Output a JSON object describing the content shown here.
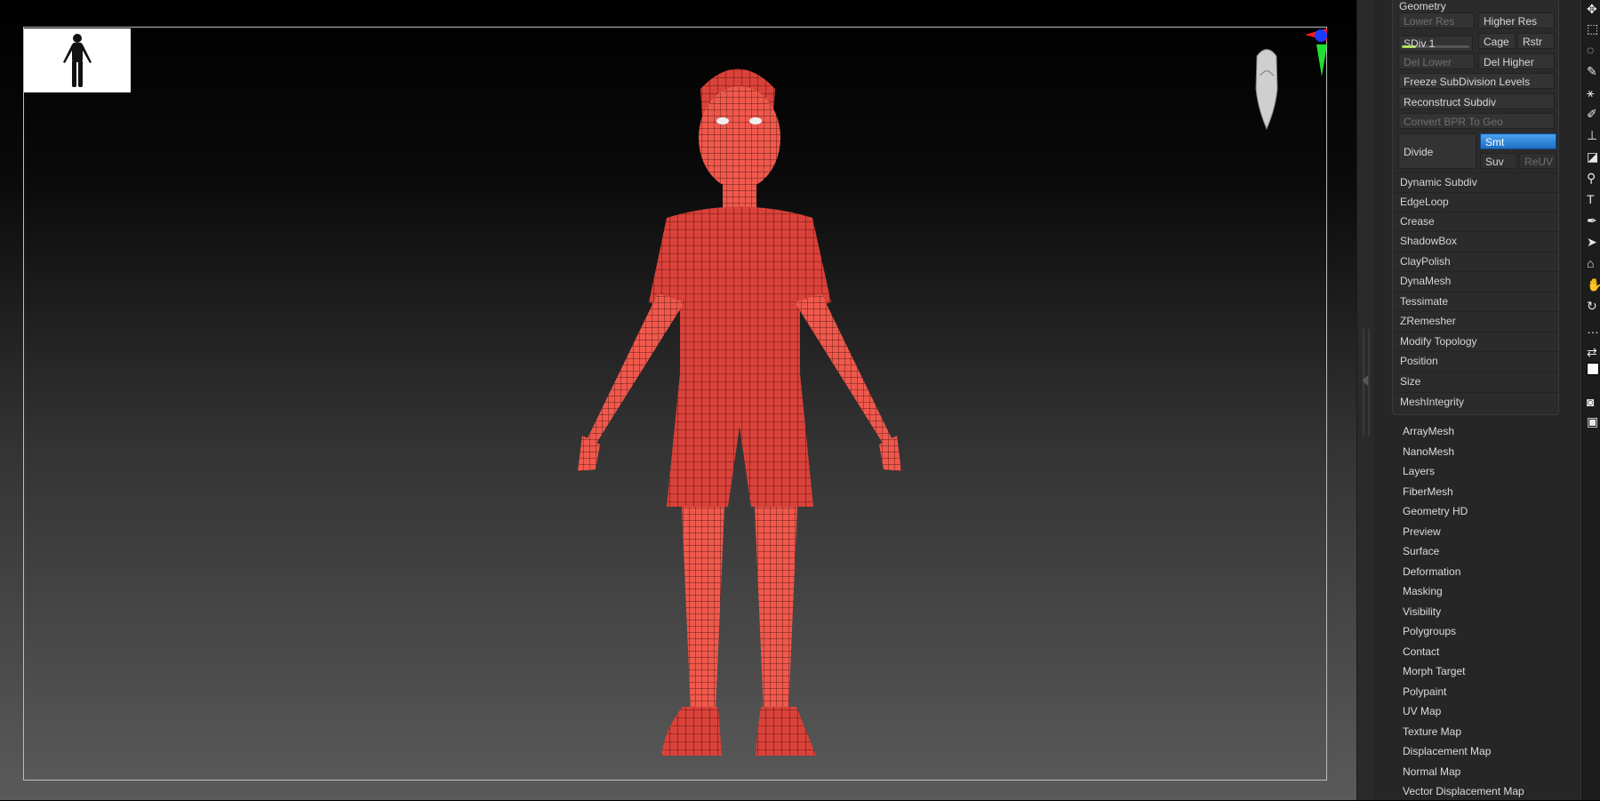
{
  "geometry": {
    "header": "Geometry",
    "lower_res": "Lower Res",
    "higher_res": "Higher Res",
    "sdiv_label": "SDiv 1",
    "sdiv_level": 0.2,
    "cage": "Cage",
    "rstr": "Rstr",
    "del_lower": "Del Lower",
    "del_higher": "Del Higher",
    "freeze": "Freeze SubDivision Levels",
    "reconstruct": "Reconstruct Subdiv",
    "convert_bpr": "Convert BPR To Geo",
    "divide": "Divide",
    "smt": "Smt",
    "suv": "Suv",
    "reuv": "ReUV",
    "subpanels": [
      "Dynamic Subdiv",
      "EdgeLoop",
      "Crease",
      "ShadowBox",
      "ClayPolish",
      "DynaMesh",
      "Tessimate",
      "ZRemesher",
      "Modify Topology",
      "Position",
      "Size",
      "MeshIntegrity"
    ]
  },
  "tool_menus": [
    "ArrayMesh",
    "NanoMesh",
    "Layers",
    "FiberMesh",
    "Geometry HD",
    "Preview",
    "Surface",
    "Deformation",
    "Masking",
    "Visibility",
    "Polygroups",
    "Contact",
    "Morph Target",
    "Polypaint",
    "UV Map",
    "Texture Map",
    "Displacement Map",
    "Normal Map",
    "Vector Displacement Map"
  ],
  "colors": {
    "model": "#d9423a",
    "accent": "#2f86e0"
  }
}
